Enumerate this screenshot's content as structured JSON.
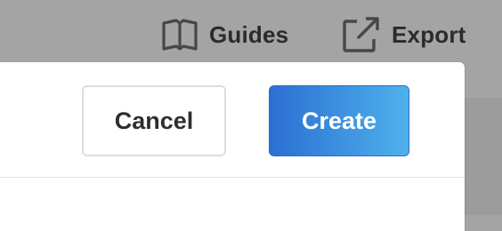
{
  "toolbar": {
    "guides": {
      "label": "Guides",
      "icon": "book-icon"
    },
    "export": {
      "label": "Export",
      "icon": "export-icon"
    }
  },
  "dialog": {
    "cancel_label": "Cancel",
    "create_label": "Create"
  },
  "colors": {
    "primary_gradient_start": "#2b6fd3",
    "primary_gradient_end": "#4fb1ec",
    "overlay": "#a4a4a4"
  }
}
